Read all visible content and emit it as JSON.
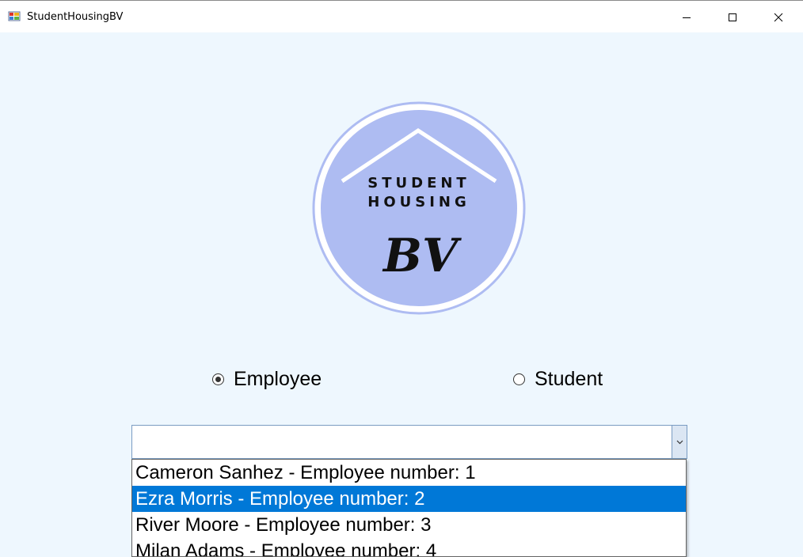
{
  "window": {
    "title": "StudentHousingBV"
  },
  "logo": {
    "line1": "STUDENT",
    "line2": "HOUSING",
    "monogram": "BV"
  },
  "role_selector": {
    "options": [
      {
        "label": "Employee",
        "checked": true
      },
      {
        "label": "Student",
        "checked": false
      }
    ]
  },
  "user_combo": {
    "value": "",
    "items": [
      {
        "label": "Cameron Sanhez - Employee number: 1",
        "selected": false
      },
      {
        "label": "Ezra Morris - Employee number: 2",
        "selected": true
      },
      {
        "label": "River Moore - Employee number: 3",
        "selected": false
      },
      {
        "label": "Milan Adams - Employee number: 4",
        "selected": false
      }
    ]
  },
  "colors": {
    "client_background": "#eef7fe",
    "logo_fill": "#aebcf2",
    "selection": "#0078d7"
  },
  "icons": [
    "app-icon",
    "minimize-icon",
    "maximize-icon",
    "close-icon",
    "chevron-down-icon",
    "house-roof-icon"
  ]
}
